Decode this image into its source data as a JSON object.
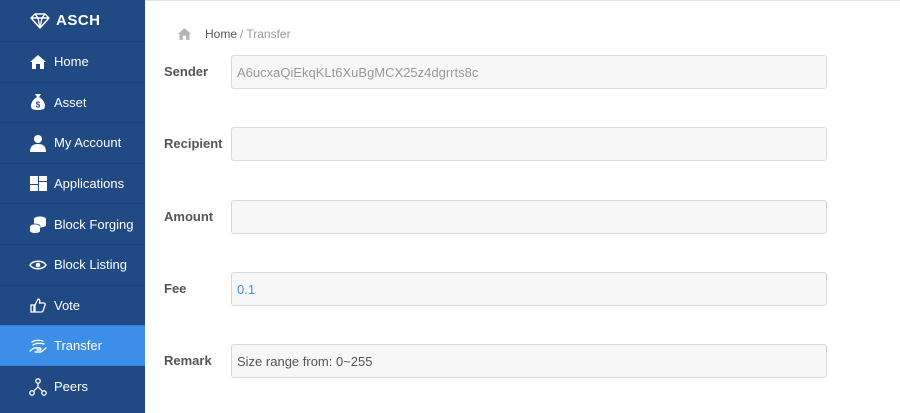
{
  "brand": {
    "name": "ASCH",
    "icon": "diamond-icon"
  },
  "sidebar": {
    "items": [
      {
        "label": "Home",
        "icon": "home-icon",
        "active": false
      },
      {
        "label": "Asset",
        "icon": "money-bag-icon",
        "active": false
      },
      {
        "label": "My Account",
        "icon": "user-icon",
        "active": false
      },
      {
        "label": "Applications",
        "icon": "grid-icon",
        "active": false
      },
      {
        "label": "Block Forging",
        "icon": "coin-stack-icon",
        "active": false
      },
      {
        "label": "Block Listing",
        "icon": "eye-icon",
        "active": false
      },
      {
        "label": "Vote",
        "icon": "thumbs-up-icon",
        "active": false
      },
      {
        "label": "Transfer",
        "icon": "transfer-hand-icon",
        "active": true
      },
      {
        "label": "Peers",
        "icon": "network-icon",
        "active": false
      }
    ]
  },
  "breadcrumb": {
    "home": "Home",
    "separator": "/",
    "current": "Transfer",
    "icon": "home-icon"
  },
  "form": {
    "sender": {
      "label": "Sender",
      "value": "A6ucxaQiEkqKLt6XuBgMCX25z4dgrrts8c"
    },
    "recipient": {
      "label": "Recipient",
      "value": ""
    },
    "amount": {
      "label": "Amount",
      "value": ""
    },
    "fee": {
      "label": "Fee",
      "value": "0.1"
    },
    "remark": {
      "label": "Remark",
      "placeholder": "Size range from: 0~255"
    }
  },
  "colors": {
    "sidebar_bg": "#214a85",
    "sidebar_active": "#3c8ee8",
    "field_value": "#4a90d9"
  }
}
